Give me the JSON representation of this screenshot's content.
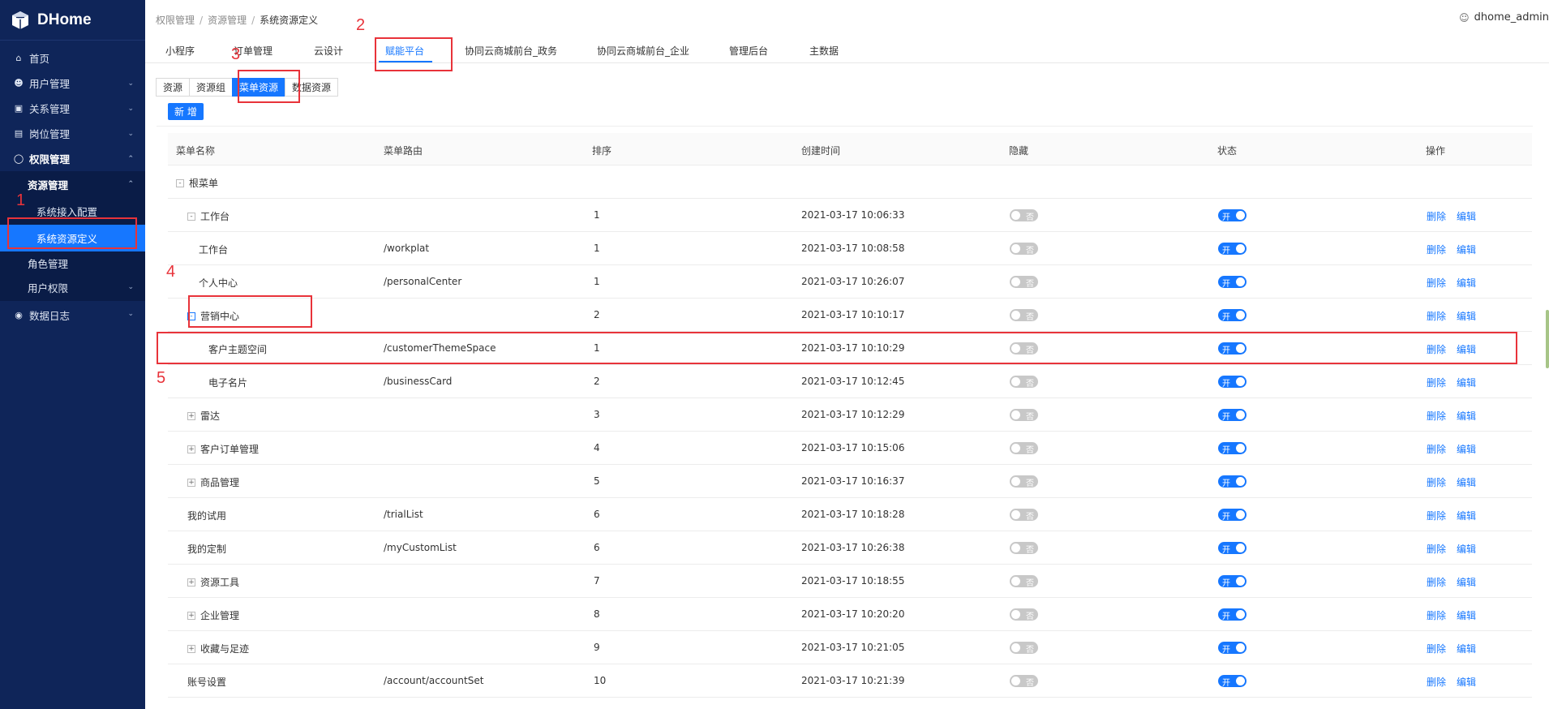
{
  "app": {
    "name": "DHome"
  },
  "user": {
    "name": "dhome_admin"
  },
  "sidebar": {
    "items": [
      {
        "label": "首页",
        "icon": "home-icon"
      },
      {
        "label": "用户管理",
        "icon": "user-icon"
      },
      {
        "label": "关系管理",
        "icon": "relation-icon"
      },
      {
        "label": "岗位管理",
        "icon": "post-icon"
      },
      {
        "label": "权限管理",
        "icon": "shield-icon"
      },
      {
        "label": "资源管理"
      },
      {
        "label": "系统接入配置"
      },
      {
        "label": "系统资源定义"
      },
      {
        "label": "角色管理"
      },
      {
        "label": "用户权限"
      },
      {
        "label": "数据日志",
        "icon": "log-icon"
      }
    ]
  },
  "breadcrumb": {
    "items": [
      "权限管理",
      "资源管理",
      "系统资源定义"
    ],
    "separator": "/"
  },
  "topnav": {
    "tabs": [
      "小程序",
      "订单管理",
      "云设计",
      "赋能平台",
      "协同云商城前台_政务",
      "协同云商城前台_企业",
      "管理后台",
      "主数据"
    ],
    "active": "赋能平台"
  },
  "subtabs": {
    "items": [
      "资源",
      "资源组",
      "菜单资源",
      "数据资源"
    ],
    "active": "菜单资源"
  },
  "toolbar": {
    "add_label": "新 增"
  },
  "table": {
    "headers": [
      "菜单名称",
      "菜单路由",
      "排序",
      "创建时间",
      "隐藏",
      "状态",
      "操作"
    ],
    "root": {
      "label": "根菜单",
      "expander": "-"
    },
    "rows": [
      {
        "name": "工作台",
        "route": "",
        "sort": "1",
        "time": "2021-03-17 10:06:33",
        "expander": "-"
      },
      {
        "name": "工作台",
        "route": "/workplat",
        "sort": "1",
        "time": "2021-03-17 10:08:58",
        "expander": ""
      },
      {
        "name": "个人中心",
        "route": "/personalCenter",
        "sort": "1",
        "time": "2021-03-17 10:26:07",
        "expander": ""
      },
      {
        "name": "营销中心",
        "route": "",
        "sort": "2",
        "time": "2021-03-17 10:10:17",
        "expander": "-"
      },
      {
        "name": "客户主题空间",
        "route": "/customerThemeSpace",
        "sort": "1",
        "time": "2021-03-17 10:10:29",
        "expander": ""
      },
      {
        "name": "电子名片",
        "route": "/businessCard",
        "sort": "2",
        "time": "2021-03-17 10:12:45",
        "expander": ""
      },
      {
        "name": "雷达",
        "route": "",
        "sort": "3",
        "time": "2021-03-17 10:12:29",
        "expander": "+"
      },
      {
        "name": "客户订单管理",
        "route": "",
        "sort": "4",
        "time": "2021-03-17 10:15:06",
        "expander": "+"
      },
      {
        "name": "商品管理",
        "route": "",
        "sort": "5",
        "time": "2021-03-17 10:16:37",
        "expander": "+"
      },
      {
        "name": "我的试用",
        "route": "/trialList",
        "sort": "6",
        "time": "2021-03-17 10:18:28",
        "expander": ""
      },
      {
        "name": "我的定制",
        "route": "/myCustomList",
        "sort": "6",
        "time": "2021-03-17 10:26:38",
        "expander": ""
      },
      {
        "name": "资源工具",
        "route": "",
        "sort": "7",
        "time": "2021-03-17 10:18:55",
        "expander": "+"
      },
      {
        "name": "企业管理",
        "route": "",
        "sort": "8",
        "time": "2021-03-17 10:20:20",
        "expander": "+"
      },
      {
        "name": "收藏与足迹",
        "route": "",
        "sort": "9",
        "time": "2021-03-17 10:21:05",
        "expander": "+"
      },
      {
        "name": "账号设置",
        "route": "/account/accountSet",
        "sort": "10",
        "time": "2021-03-17 10:21:39",
        "expander": ""
      }
    ],
    "hidden_label": "否",
    "status_label": "开",
    "delete_label": "删除",
    "edit_label": "编辑"
  },
  "annotations": [
    "1",
    "2",
    "3",
    "4",
    "5"
  ],
  "colors": {
    "sidebar_bg": "#0f2559",
    "accent": "#1677ff",
    "annotation": "#e8333a"
  }
}
